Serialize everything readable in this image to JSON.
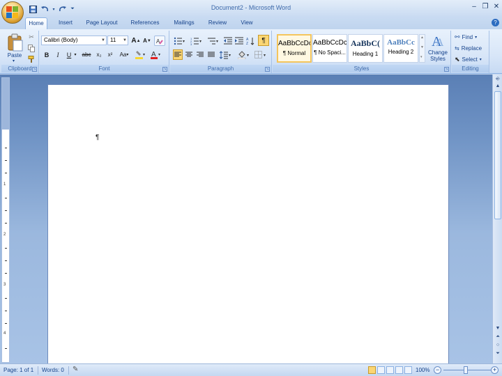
{
  "window": {
    "title": "Document2 - Microsoft Word"
  },
  "quick_access": {
    "save_icon": "save-icon",
    "undo_icon": "undo-icon",
    "redo_icon": "redo-icon",
    "customize_icon": "customize-qat-icon"
  },
  "tabs": [
    {
      "label": "Home",
      "active": true
    },
    {
      "label": "Insert"
    },
    {
      "label": "Page Layout"
    },
    {
      "label": "References"
    },
    {
      "label": "Mailings"
    },
    {
      "label": "Review"
    },
    {
      "label": "View"
    }
  ],
  "ribbon": {
    "clipboard": {
      "label": "Clipboard",
      "paste_label": "Paste"
    },
    "font": {
      "label": "Font",
      "font_name": "Calibri (Body)",
      "font_size": "11",
      "bold": "B",
      "italic": "I",
      "underline": "U",
      "strike": "abc",
      "subscript": "x₂",
      "superscript": "x²",
      "change_case": "Aa",
      "grow": "A",
      "shrink": "A"
    },
    "paragraph": {
      "label": "Paragraph",
      "pilcrow": "¶"
    },
    "styles": {
      "label": "Styles",
      "items": [
        {
          "sample": "AaBbCcDc",
          "name": "¶ Normal",
          "selected": true
        },
        {
          "sample": "AaBbCcDc",
          "name": "¶ No Spaci..."
        },
        {
          "sample": "AaBbC(",
          "name": "Heading 1"
        },
        {
          "sample": "AaBbCc",
          "name": "Heading 2"
        }
      ],
      "change_styles_line1": "Change",
      "change_styles_line2": "Styles"
    },
    "editing": {
      "label": "Editing",
      "find": "Find",
      "replace": "Replace",
      "select": "Select"
    }
  },
  "document": {
    "paragraph_mark": "¶"
  },
  "status": {
    "page": "Page: 1 of 1",
    "words": "Words: 0",
    "zoom": "100%"
  },
  "ruler_numbers": [
    "1",
    "2",
    "3",
    "4"
  ],
  "colors": {
    "accent": "#15428b",
    "highlight": "#f7d72f",
    "font_color": "#e02020"
  }
}
